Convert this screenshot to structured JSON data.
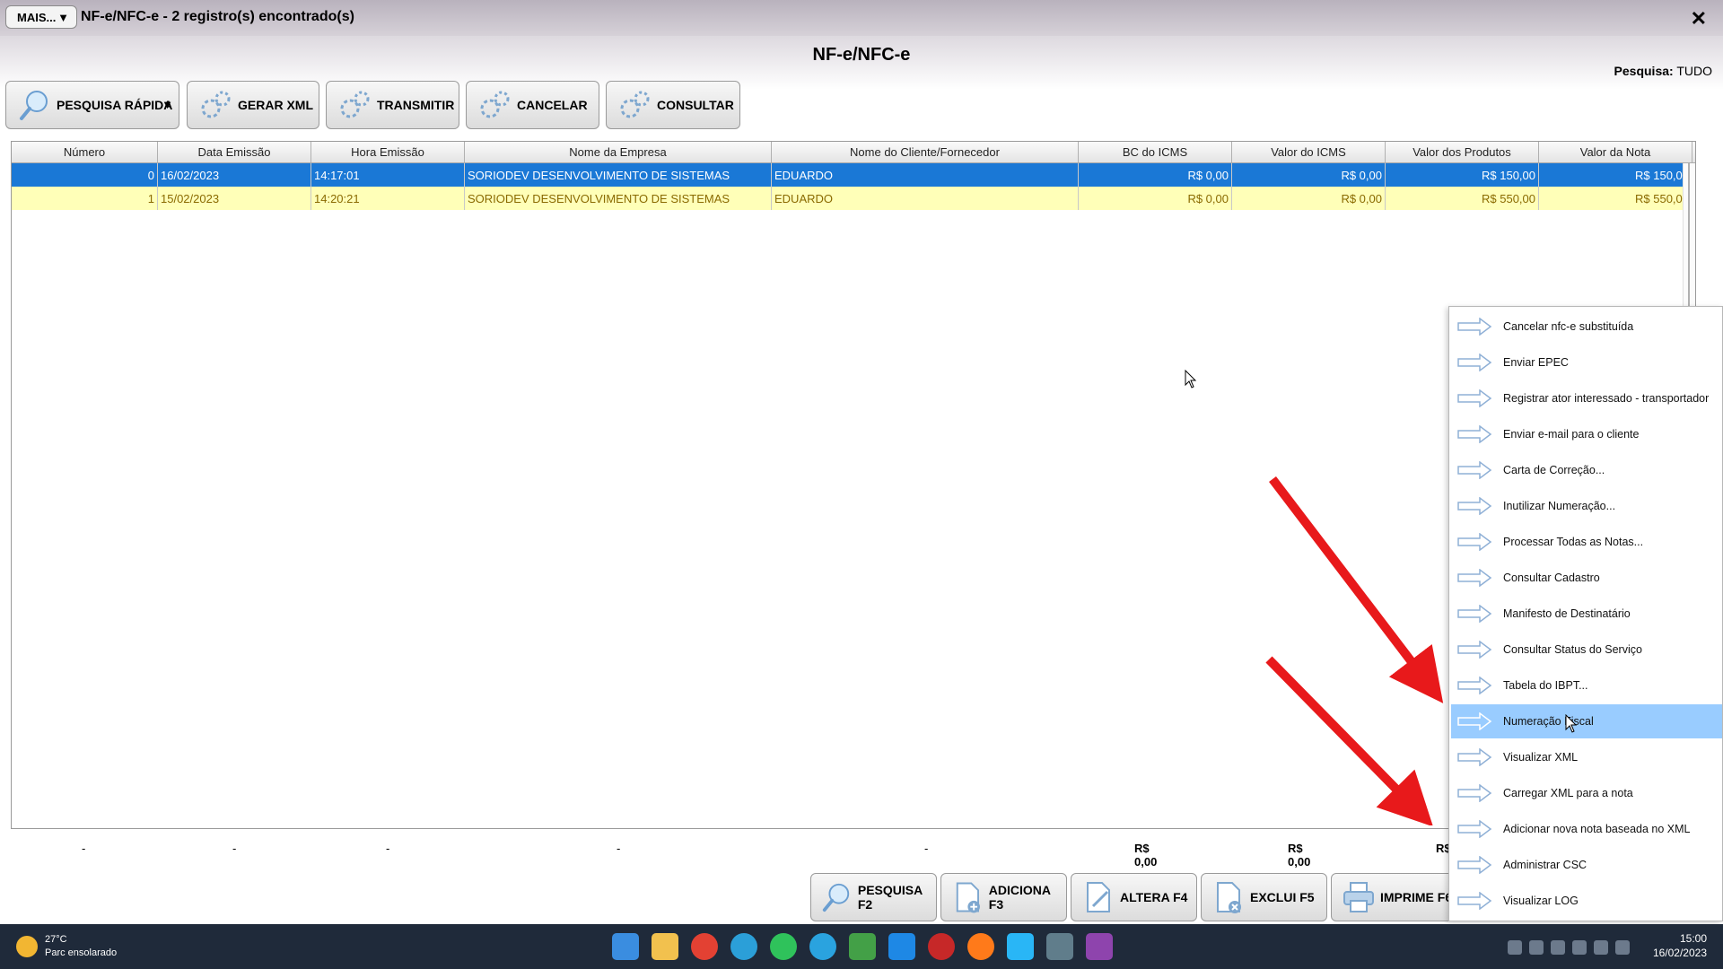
{
  "window": {
    "mais_label": "MAIS...",
    "title": "NF-e/NFC-e - 2 registro(s) encontrado(s)",
    "close_glyph": "✕"
  },
  "page": {
    "title": "NF-e/NFC-e",
    "search_label": "Pesquisa:",
    "search_value": "TUDO"
  },
  "toolbar": {
    "quick_search": "PESQUISA RÁPIDA",
    "quick_search_caret": "▼",
    "generate_xml": "GERAR XML",
    "transmit": "TRANSMITIR",
    "cancel": "CANCELAR",
    "consult": "CONSULTAR"
  },
  "grid": {
    "columns": [
      "Número",
      "Data Emissão",
      "Hora Emissão",
      "Nome da Empresa",
      "Nome do Cliente/Fornecedor",
      "BC do ICMS",
      "Valor do ICMS",
      "Valor dos Produtos",
      "Valor da Nota"
    ],
    "rows": [
      [
        "0",
        "16/02/2023",
        "14:17:01",
        "SORIODEV DESENVOLVIMENTO DE SISTEMAS",
        "EDUARDO",
        "R$ 0,00",
        "R$ 0,00",
        "R$ 150,00",
        "R$ 150,00"
      ],
      [
        "1",
        "15/02/2023",
        "14:20:21",
        "SORIODEV DESENVOLVIMENTO DE SISTEMAS",
        "EDUARDO",
        "R$ 0,00",
        "R$ 0,00",
        "R$ 550,00",
        "R$ 550,00"
      ]
    ],
    "totals": [
      "-",
      "-",
      "-",
      "-",
      "-",
      "R$ 0,00",
      "R$ 0,00",
      "R$"
    ]
  },
  "bottom_buttons": {
    "search": "PESQUISA F2",
    "add": "ADICIONA F3",
    "edit": "ALTERA F4",
    "delete": "EXCLUI F5",
    "print": "IMPRIME F6"
  },
  "menu": {
    "items": [
      "Cancelar nfc-e substituída",
      "Enviar EPEC",
      "Registrar ator interessado - transportador",
      "Enviar e-mail para o cliente",
      "Carta de Correção...",
      "Inutilizar Numeração...",
      "Processar Todas as Notas...",
      "Consultar Cadastro",
      "Manifesto de Destinatário",
      "Consultar Status do Serviço",
      "Tabela do IBPT...",
      "Numeração Fiscal",
      "Visualizar XML",
      "Carregar XML para a nota",
      "Adicionar nova nota baseada no XML",
      "Administrar CSC",
      "Visualizar LOG"
    ],
    "highlighted_index": 11
  },
  "taskbar": {
    "temperature": "27°C",
    "weather": "Parc ensolarado",
    "time": "15:00",
    "date": "16/02/2023"
  },
  "colors": {
    "selected_row": "#1a78d6",
    "zebra_row": "#ffffb8",
    "menu_highlight": "#99ccff",
    "annotation_arrow": "#e8191b"
  }
}
